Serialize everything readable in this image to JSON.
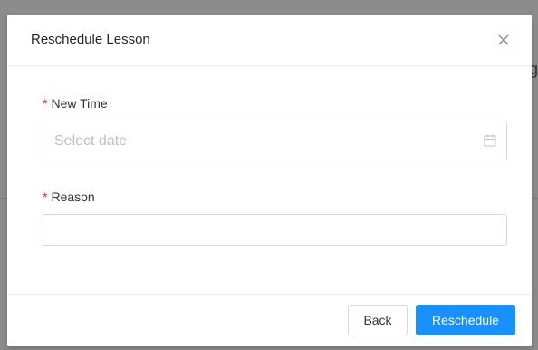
{
  "backdrop": {
    "partial_text": "g"
  },
  "modal": {
    "title": "Reschedule Lesson",
    "close_icon": "close-icon"
  },
  "form": {
    "new_time": {
      "required_mark": "*",
      "label": "New Time",
      "placeholder": "Select date",
      "icon": "calendar-icon"
    },
    "reason": {
      "required_mark": "*",
      "label": "Reason",
      "value": ""
    }
  },
  "footer": {
    "back_label": "Back",
    "submit_label": "Reschedule"
  },
  "colors": {
    "primary": "#1890ff",
    "required": "#f5222d",
    "overlay": "#8c8c8c"
  }
}
